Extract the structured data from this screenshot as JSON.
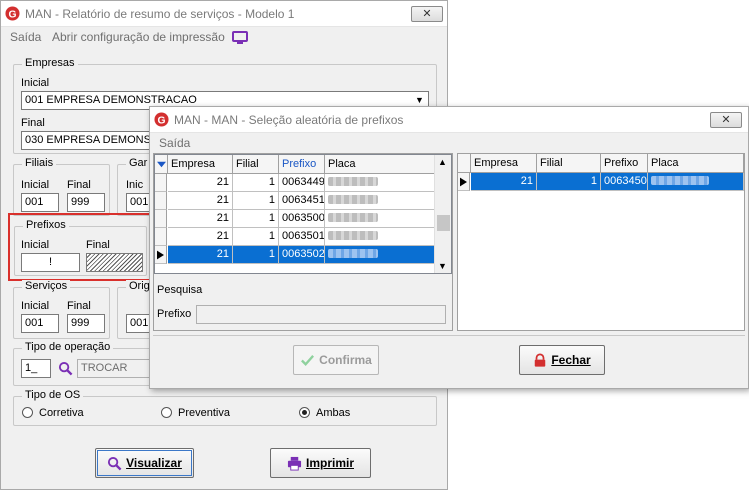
{
  "main": {
    "title": "MAN - Relatório de resumo de serviços  - Modelo 1",
    "close": "✕",
    "menu": {
      "exit": "Saída",
      "open_config": "Abrir configuração de impressão"
    },
    "empresas": {
      "title": "Empresas",
      "initial_label": "Inicial",
      "initial_value": "001 EMPRESA DEMONSTRACAO",
      "final_label": "Final",
      "final_value": "030 EMPRESA DEMONST"
    },
    "filiais": {
      "title": "Filiais",
      "initial_label": "Inicial",
      "final_label": "Final",
      "initial_value": "001",
      "final_value": "999"
    },
    "garagens": {
      "title": "Gar",
      "initial_label": "Inic",
      "initial_value": "001"
    },
    "prefixos": {
      "title": "Prefixos",
      "initial_label": "Inicial",
      "final_label": "Final",
      "initial_value": "!"
    },
    "servicos": {
      "title": "Serviços",
      "initial_label": "Inicial",
      "final_label": "Final",
      "initial_value": "001",
      "final_value": "999"
    },
    "origem": {
      "title": "Orig",
      "initial_value": "001"
    },
    "tipo_operacao": {
      "title": "Tipo de operação",
      "code": "1_",
      "description": "TROCAR"
    },
    "tipo_os": {
      "title": "Tipo de OS",
      "options": [
        "Corretiva",
        "Preventiva",
        "Ambas"
      ],
      "selected": "Ambas"
    },
    "buttons": {
      "visualizar": "Visualizar",
      "imprimir": "Imprimir"
    }
  },
  "dialog": {
    "title": "MAN - MAN - Seleção aleatória de prefixos",
    "close": "✕",
    "menu": {
      "exit": "Saída"
    },
    "left_grid": {
      "columns": [
        "Empresa",
        "Filial",
        "Prefixo",
        "Placa"
      ],
      "rows": [
        {
          "empresa": "21",
          "filial": "1",
          "prefixo": "0063449"
        },
        {
          "empresa": "21",
          "filial": "1",
          "prefixo": "0063451"
        },
        {
          "empresa": "21",
          "filial": "1",
          "prefixo": "0063500"
        },
        {
          "empresa": "21",
          "filial": "1",
          "prefixo": "0063501"
        },
        {
          "empresa": "21",
          "filial": "1",
          "prefixo": "0063502"
        }
      ]
    },
    "right_grid": {
      "columns": [
        "Empresa",
        "Filial",
        "Prefixo",
        "Placa"
      ],
      "rows": [
        {
          "empresa": "21",
          "filial": "1",
          "prefixo": "0063450"
        }
      ]
    },
    "search": {
      "label": "Pesquisa",
      "prefix_label": "Prefixo",
      "value": ""
    },
    "buttons": {
      "confirma": "Confirma",
      "fechar": "Fechar"
    }
  },
  "colors": {
    "accent": "#0a6fd2",
    "highlight_border": "#d9302c",
    "logo": "#d32f2f",
    "icon_purple": "#7a2fb5"
  }
}
